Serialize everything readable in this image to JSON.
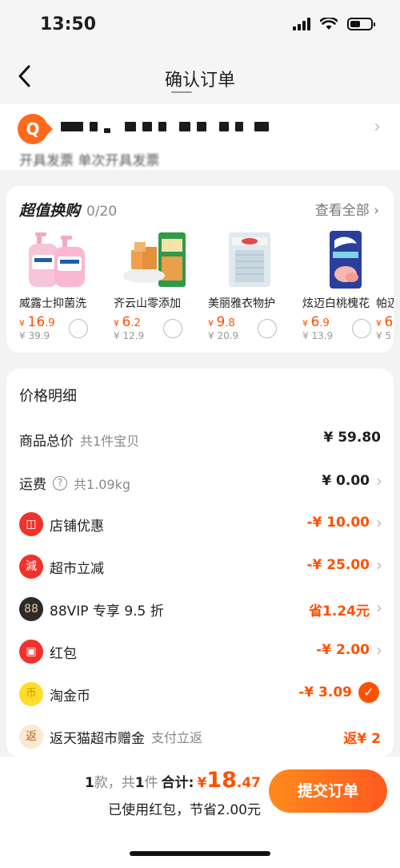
{
  "status_bar": {
    "time": "13:50"
  },
  "nav": {
    "title": "确认订单"
  },
  "address": {
    "pin": "Q",
    "subline": "开具发票    单次开具发票"
  },
  "swap": {
    "title": "超值换购",
    "count": "0/20",
    "view_all": "查看全部",
    "products": [
      {
        "name": "威露士抑菌洗",
        "price_int": "16",
        "price_dec": ".9",
        "orig": "¥ 39.9"
      },
      {
        "name": "齐云山零添加",
        "price_int": "6",
        "price_dec": ".2",
        "orig": "¥ 12.9"
      },
      {
        "name": "美丽雅衣物护",
        "price_int": "9",
        "price_dec": ".8",
        "orig": "¥ 20.9"
      },
      {
        "name": "炫迈白桃槐花",
        "price_int": "6",
        "price_dec": ".9",
        "orig": "¥ 13.9"
      },
      {
        "name": "帕迈",
        "price_int": "6",
        "price_dec": "",
        "orig": "¥ 5"
      }
    ]
  },
  "price": {
    "title": "价格明细",
    "total": {
      "label": "商品总价",
      "hint": "共1件宝贝",
      "value": "¥ 59.80"
    },
    "shipping": {
      "label": "运费",
      "hint": "共1.09kg",
      "value": "¥ 0.00"
    },
    "shop_discount": {
      "label": "店铺优惠",
      "value": "-¥ 10.00"
    },
    "market_discount": {
      "label": "超市立减",
      "value": "-¥ 25.00"
    },
    "vip": {
      "label": "88VIP 专享 9.5 折",
      "value": "省1.24元"
    },
    "redpacket": {
      "label": "红包",
      "value": "-¥ 2.00"
    },
    "coin": {
      "label": "淘金币",
      "value": "-¥ 3.09"
    },
    "cashback": {
      "label": "返天猫超市赠金",
      "hint": "支付立返",
      "value": "返¥ 2"
    }
  },
  "bottom": {
    "count_prefix": "1",
    "count_mid": "款，共",
    "count_num": "1",
    "count_suffix": "件",
    "total_label": "合计:",
    "currency": "¥",
    "amount_int": "18",
    "amount_dec": ".47",
    "savings": "已使用红包，节省2.00元",
    "submit": "提交订单"
  },
  "colors": {
    "accent": "#ff5000",
    "background": "#f3f3f3"
  }
}
